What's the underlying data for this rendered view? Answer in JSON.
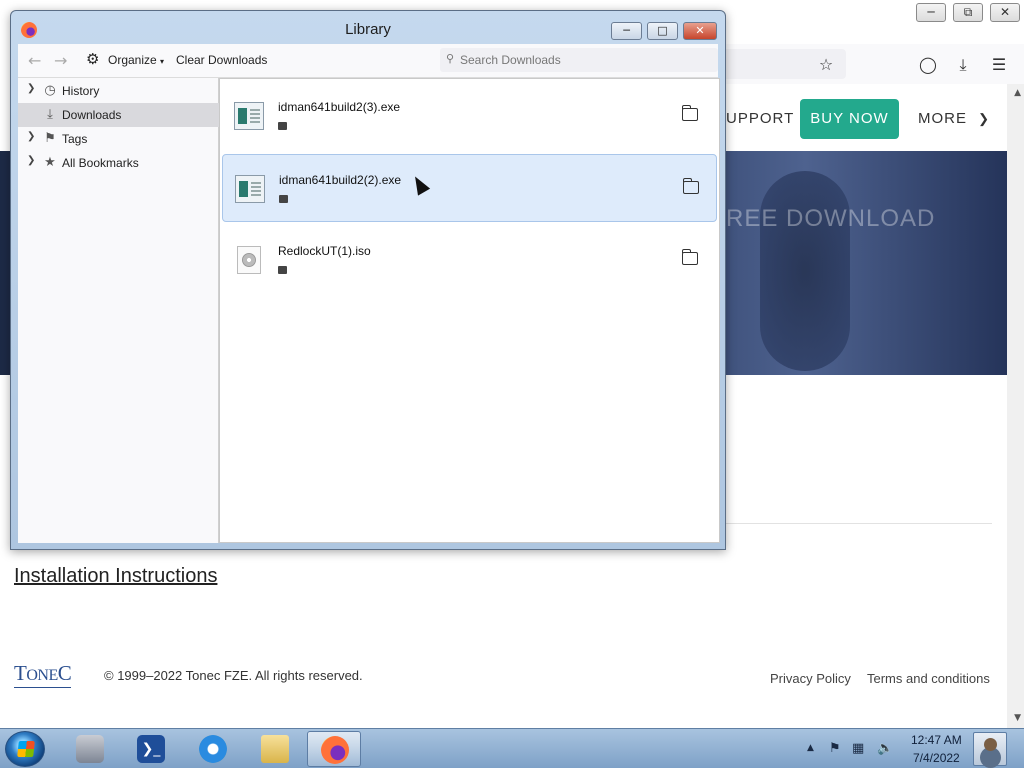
{
  "browser": {
    "nav": {
      "support": "UPPORT",
      "buy_now": "BUY NOW",
      "more": "MORE"
    },
    "hero_text": "REE DOWNLOAD",
    "installation_link": "Installation Instructions",
    "footer": {
      "logo": "TONEC",
      "copyright": "© 1999–2022 Tonec FZE. All rights reserved.",
      "privacy": "Privacy Policy",
      "terms": "Terms and conditions"
    }
  },
  "library": {
    "title": "Library",
    "toolbar": {
      "organize": "Organize",
      "clear_downloads": "Clear Downloads",
      "search_placeholder": "Search Downloads"
    },
    "sidebar": {
      "items": [
        {
          "label": "History",
          "icon": "clock-icon",
          "expandable": true,
          "selected": false
        },
        {
          "label": "Downloads",
          "icon": "download-icon",
          "expandable": false,
          "selected": true
        },
        {
          "label": "Tags",
          "icon": "tag-icon",
          "expandable": true,
          "selected": false
        },
        {
          "label": "All Bookmarks",
          "icon": "star-icon",
          "expandable": true,
          "selected": false
        }
      ]
    },
    "downloads": [
      {
        "name": "idman641build2(3).exe",
        "type": "exe",
        "selected": false
      },
      {
        "name": "idman641build2(2).exe",
        "type": "exe",
        "selected": true
      },
      {
        "name": "RedlockUT(1).iso",
        "type": "iso",
        "selected": false
      }
    ]
  },
  "taskbar": {
    "clock_time": "12:47 AM",
    "clock_date": "7/4/2022",
    "apps": [
      "server-manager",
      "powershell",
      "internet-explorer",
      "file-explorer",
      "firefox"
    ]
  }
}
